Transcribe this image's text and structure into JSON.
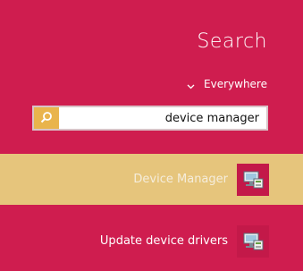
{
  "panel": {
    "title": "Search",
    "scope": {
      "label": "Everywhere",
      "icon": "chevron-down-icon"
    }
  },
  "search": {
    "value": "device manager",
    "button_icon": "search-icon"
  },
  "results": [
    {
      "label": "Device Manager",
      "icon": "device-manager-icon",
      "selected": true
    },
    {
      "label": "Update device drivers",
      "icon": "device-manager-icon",
      "selected": false
    }
  ],
  "colors": {
    "background": "#cf1d4f",
    "selected_row": "#e6c57c",
    "search_button": "#e9b44c",
    "icon_tile": "#c31949"
  }
}
